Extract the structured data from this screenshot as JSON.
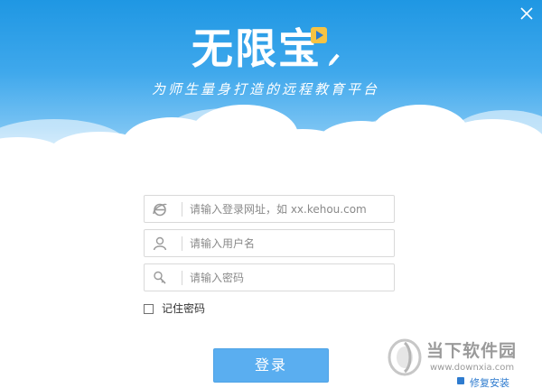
{
  "window": {
    "close_icon": "close-icon"
  },
  "header": {
    "app_title": "无限宝",
    "tagline": "为师生量身打造的远程教育平台",
    "colors": {
      "sky_top": "#1f97e3",
      "sky_bottom": "#bfe3fb",
      "cloud": "#ffffff"
    }
  },
  "form": {
    "url_field": {
      "placeholder": "请输入登录网址，如 xx.kehou.com",
      "value": "",
      "icon": "ie-browser-icon"
    },
    "username_field": {
      "placeholder": "请输入用户名",
      "value": "",
      "icon": "user-icon"
    },
    "password_field": {
      "placeholder": "请输入密码",
      "value": "",
      "icon": "key-icon"
    },
    "remember_label": "记住密码",
    "remember_checked": false,
    "login_label": "登录",
    "login_color": "#5aaef0"
  },
  "watermark": {
    "name": "当下软件园",
    "url": "www.downxia.com",
    "link_label": "修复安装"
  }
}
